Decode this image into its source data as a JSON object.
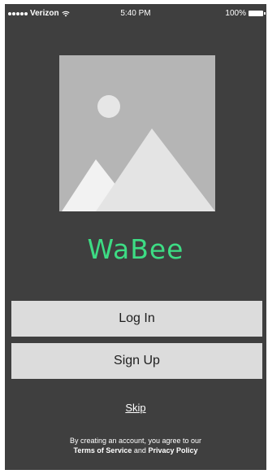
{
  "status_bar": {
    "carrier": "Verizon",
    "time": "5:40 PM",
    "battery": "100%"
  },
  "brand": {
    "name": "WaBee",
    "color": "#3ddc84"
  },
  "buttons": {
    "login_label": "Log In",
    "signup_label": "Sign Up"
  },
  "skip_label": "Skip",
  "terms": {
    "line1": "By creating an account, you agree to our",
    "terms_label": "Terms of Service",
    "and": "and",
    "privacy_label": "Privacy Policy"
  },
  "icons": {
    "hero": "image-placeholder-icon",
    "wifi": "wifi-icon",
    "battery": "battery-icon"
  }
}
